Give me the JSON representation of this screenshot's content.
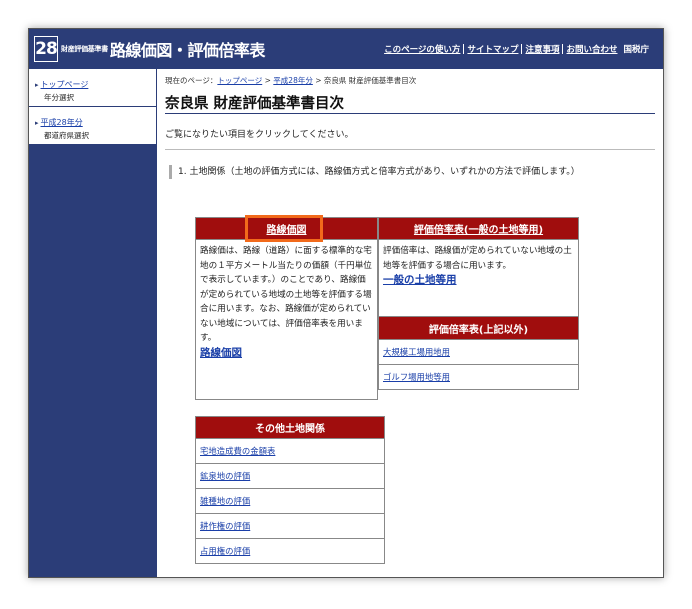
{
  "header": {
    "logo_number": "28",
    "logo_small": "財産評価基準書",
    "logo_main": "路線価図・評価倍率表",
    "links": [
      "このページの使い方",
      "サイトマップ",
      "注意事項",
      "お問い合わせ"
    ],
    "agency": "国税庁"
  },
  "sidebar": {
    "items": [
      {
        "label": "トップページ",
        "sub": "年分選択"
      },
      {
        "label": "平成28年分",
        "sub": "都道府県選択"
      }
    ]
  },
  "breadcrumb": {
    "prefix": "現在のページ：",
    "top": "トップページ",
    "sep1": ">",
    "year": "平成28年分",
    "sep2": ">",
    "current": "奈良県 財産評価基準書目次"
  },
  "page_title": "奈良県 財産評価基準書目次",
  "intro": "ご覧になりたい項目をクリックしてください。",
  "section1": "1. 土地関係（土地の評価方式には、路線価方式と倍率方式があり、いずれかの方法で評価します。）",
  "rosen": {
    "header": "路線価図",
    "desc": "路線価は、路線（道路）に面する標準的な宅地の１平方メートル当たりの価額（千円単位で表示しています。）のことであり、路線価が定められている地域の土地等を評価する場合に用います。なお、路線価が定められていない地域については、評価倍率表を用います。",
    "link": "路線価図"
  },
  "bairitsu": {
    "header": "評価倍率表(一般の土地等用)",
    "desc": "評価倍率は、路線価が定められていない地域の土地等を評価する場合に用います。",
    "link": "一般の土地等用",
    "other_header": "評価倍率表(上記以外)",
    "other_links": [
      "大規模工場用地用",
      "ゴルフ場用地等用"
    ]
  },
  "other": {
    "header": "その他土地関係",
    "links": [
      "宅地造成費の金額表",
      "鉱泉地の評価",
      "雑種地の評価",
      "耕作権の評価",
      "占用権の評価"
    ]
  },
  "colors": {
    "navy": "#2b3d78",
    "red": "#a00d0d",
    "link": "#1a3fa8",
    "highlight": "#f26a1b"
  }
}
